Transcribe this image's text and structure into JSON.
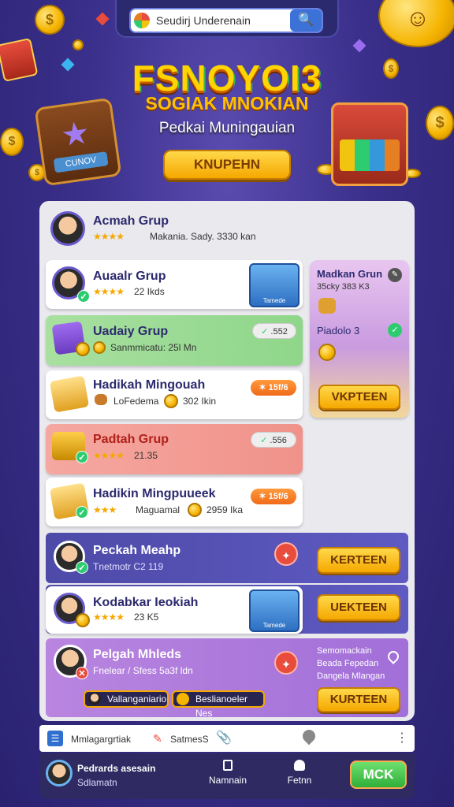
{
  "search": {
    "value": "Seudirj Underenain",
    "button_icon": "search-icon"
  },
  "hero": {
    "title": "FSNOYOI3",
    "subtitle": "SOGIAK MNOKIAN",
    "description": "Pedkai Muningauian",
    "button_label": "KNUPEHN",
    "chest_label": "CUNOV"
  },
  "top_card": {
    "title": "Acmah Grup",
    "rating": "★★★★",
    "meta": "Makania. Sady. 3330 kan"
  },
  "list": [
    {
      "title": "Auaalr Grup",
      "rating": "★★★★",
      "meta": "22 Ikds",
      "tile_label": "Tamede"
    },
    {
      "title": "Uadaiy Grup",
      "meta": "Sanmmicatu: 25l Mn",
      "pill": ".552"
    },
    {
      "title": "Hadikah Mingouah",
      "sub": "LoFedema",
      "meta": "302 Ikin",
      "pill": "15f/6"
    },
    {
      "title": "Padtah Grup",
      "rating": "★★★★",
      "meta": "21.35",
      "pill": ".556"
    },
    {
      "title": "Hadikin Mingpuueek",
      "rating": "★★★",
      "sub": "Maguamal",
      "meta": "2959 Ika",
      "pill": "15f/6"
    }
  ],
  "side_panel": {
    "title": "Madkan Grun",
    "meta": "35cky 383 K3",
    "item": "Piadolo 3",
    "button": "VKPTEEN"
  },
  "purple_rows": [
    {
      "title": "Peckah Meahp",
      "meta": "Tnetmotr C2 119",
      "button": "KERTEEN"
    },
    {
      "title": "Kodabkar Ieokiah",
      "rating": "★★★★",
      "meta": "23 K5",
      "tile_label": "Tamede",
      "button": "UEKTEEN"
    }
  ],
  "lilac_row": {
    "title": "Pelgah Mhleds",
    "meta": "Fnelear / Sfess 5a3f ldn",
    "side_text": [
      "Semomackain",
      "Beada Fepedan",
      "Dangela Mlangan"
    ],
    "tag1": "Vallanganiario",
    "tag2": "Beslianoeler Nes",
    "button": "KURTEEN"
  },
  "toolbar": {
    "left_label": "Mmlagargrtiak",
    "middle_label": "SatmesS",
    "more_icon": "more-vertical-icon"
  },
  "bottom_nav": {
    "profile_name": "Pedrards asesain",
    "profile_sub": "Sdlamatn",
    "nav1": "Namnain",
    "nav2": "Fetnn",
    "action": "MCK"
  },
  "colors": {
    "accent_gold": "#f5a800",
    "panel_bg": "#e9e9ee",
    "purple": "#4d4aa8",
    "green": "#2ecc71"
  }
}
